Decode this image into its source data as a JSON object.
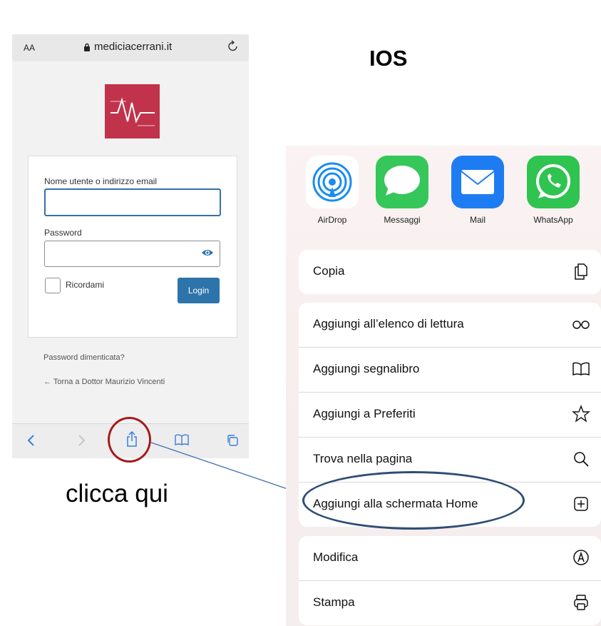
{
  "browser": {
    "text_size": "AA",
    "url": "mediciacerrani.it",
    "reload_icon": "reload-icon"
  },
  "login_form": {
    "username_label": "Nome utente o indirizzo email",
    "username_value": "",
    "password_label": "Password",
    "password_value": "",
    "remember_label": "Ricordami",
    "login_button": "Login",
    "forgot_password": "Password dimenticata?",
    "back_link": "← Torna a Dottor Maurizio Vincenti"
  },
  "toolbar": {
    "items": [
      "back-icon",
      "forward-icon",
      "share-icon",
      "bookmarks-icon",
      "tabs-icon"
    ]
  },
  "annotations": {
    "platform": "IOS",
    "instruction": "clicca qui",
    "highlight_color": "#a51c1c",
    "oval_color": "#2f4d75"
  },
  "share_sheet": {
    "apps": [
      {
        "label": "AirDrop",
        "icon": "airdrop-icon"
      },
      {
        "label": "Messaggi",
        "icon": "messages-icon"
      },
      {
        "label": "Mail",
        "icon": "mail-icon"
      },
      {
        "label": "WhatsApp",
        "icon": "whatsapp-icon"
      }
    ],
    "group1": [
      {
        "label": "Copia",
        "icon": "copy-icon"
      }
    ],
    "group2": [
      {
        "label": "Aggiungi all’elenco di lettura",
        "icon": "reading-list-icon"
      },
      {
        "label": "Aggiungi segnalibro",
        "icon": "bookmark-icon"
      },
      {
        "label": "Aggiungi a Preferiti",
        "icon": "star-icon"
      },
      {
        "label": "Trova nella pagina",
        "icon": "search-icon"
      },
      {
        "label": "Aggiungi alla schermata Home",
        "icon": "add-square-icon"
      }
    ],
    "group3": [
      {
        "label": "Modifica",
        "icon": "markup-icon"
      },
      {
        "label": "Stampa",
        "icon": "print-icon"
      }
    ]
  }
}
